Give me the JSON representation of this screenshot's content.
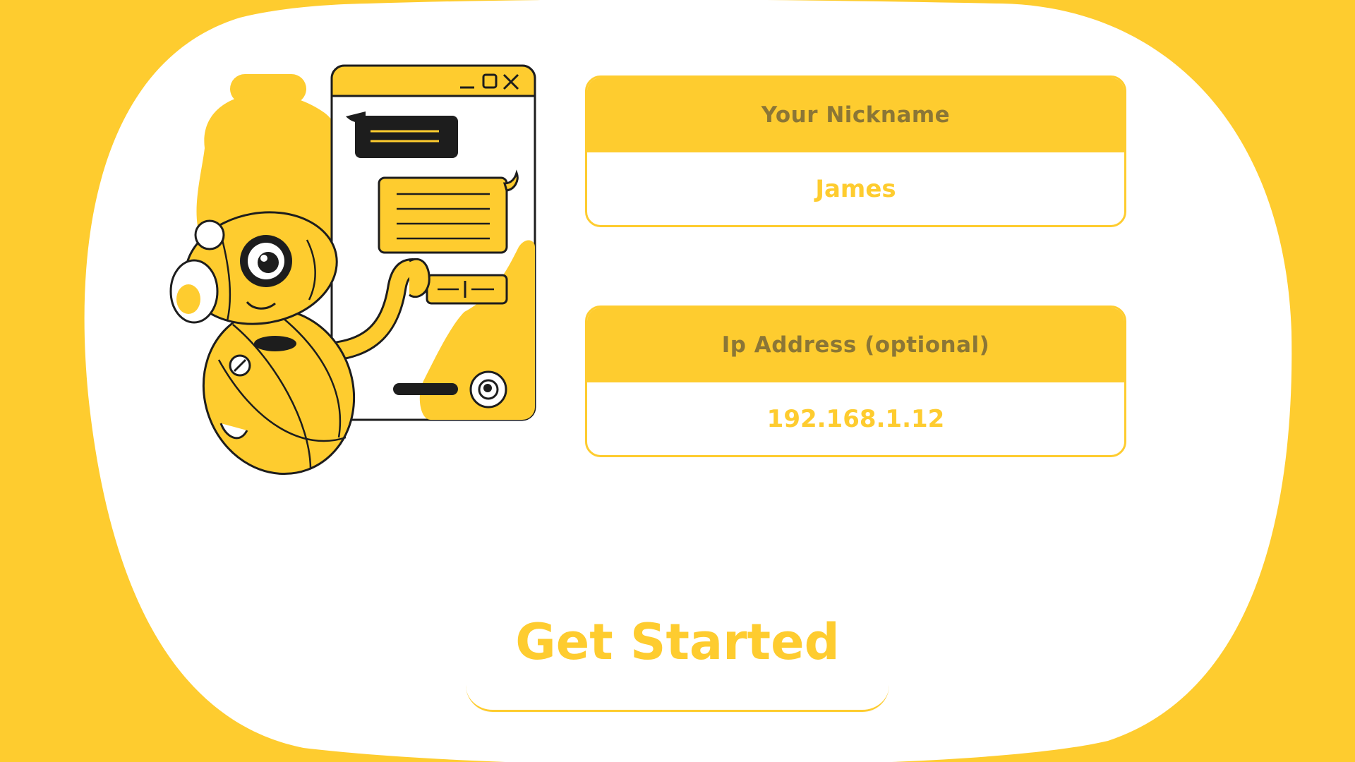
{
  "colors": {
    "accent": "#FECC2F",
    "label_text": "#8B7636",
    "background": "#FFFFFF",
    "ink": "#1D1D1D"
  },
  "form": {
    "nickname": {
      "label": "Your Nickname",
      "value": "James"
    },
    "ip_address": {
      "label": "Ip Address (optional)",
      "value": "192.168.1.12"
    },
    "submit_label": "Get Started"
  },
  "illustration": {
    "subject": "robot-chat-illustration",
    "window_controls": [
      "minimize-icon",
      "maximize-icon",
      "close-icon"
    ]
  }
}
